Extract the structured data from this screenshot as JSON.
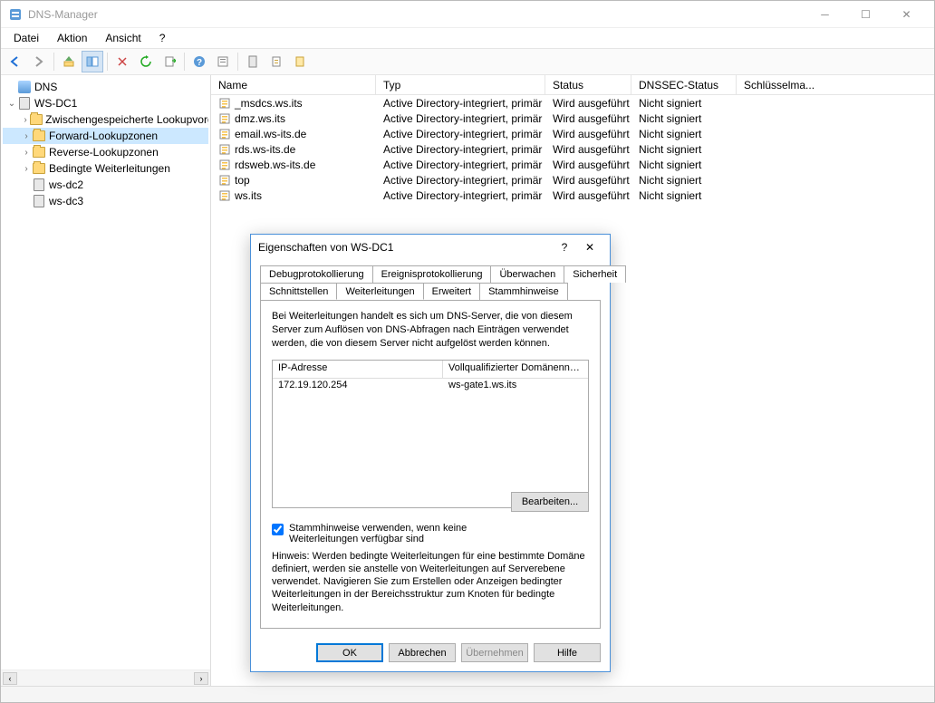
{
  "window": {
    "title": "DNS-Manager"
  },
  "menu": {
    "file": "Datei",
    "action": "Aktion",
    "view": "Ansicht",
    "help": "?"
  },
  "tree": {
    "root": "DNS",
    "server": "WS-DC1",
    "cached": "Zwischengespeicherte Lookupvorgänge",
    "forward": "Forward-Lookupzonen",
    "reverse": "Reverse-Lookupzonen",
    "conditional": "Bedingte Weiterleitungen",
    "node_wsdc2": "ws-dc2",
    "node_wsdc3": "ws-dc3"
  },
  "columns": {
    "name": "Name",
    "type": "Typ",
    "status": "Status",
    "dnssec": "DNSSEC-Status",
    "keymaster": "Schlüsselma..."
  },
  "zones": [
    {
      "name": "_msdcs.ws.its",
      "type": "Active Directory-integriert, primär",
      "status": "Wird ausgeführt",
      "dnssec": "Nicht signiert"
    },
    {
      "name": "dmz.ws.its",
      "type": "Active Directory-integriert, primär",
      "status": "Wird ausgeführt",
      "dnssec": "Nicht signiert"
    },
    {
      "name": "email.ws-its.de",
      "type": "Active Directory-integriert, primär",
      "status": "Wird ausgeführt",
      "dnssec": "Nicht signiert"
    },
    {
      "name": "rds.ws-its.de",
      "type": "Active Directory-integriert, primär",
      "status": "Wird ausgeführt",
      "dnssec": "Nicht signiert"
    },
    {
      "name": "rdsweb.ws-its.de",
      "type": "Active Directory-integriert, primär",
      "status": "Wird ausgeführt",
      "dnssec": "Nicht signiert"
    },
    {
      "name": "top",
      "type": "Active Directory-integriert, primär",
      "status": "Wird ausgeführt",
      "dnssec": "Nicht signiert"
    },
    {
      "name": "ws.its",
      "type": "Active Directory-integriert, primär",
      "status": "Wird ausgeführt",
      "dnssec": "Nicht signiert"
    }
  ],
  "dialog": {
    "title": "Eigenschaften von WS-DC1",
    "tabs_row1": {
      "debug": "Debugprotokollierung",
      "event": "Ereignisprotokollierung",
      "monitor": "Überwachen",
      "security": "Sicherheit"
    },
    "tabs_row2": {
      "interfaces": "Schnittstellen",
      "forwarders": "Weiterleitungen",
      "advanced": "Erweitert",
      "roothints": "Stammhinweise"
    },
    "desc": "Bei Weiterleitungen handelt es sich um DNS-Server, die von diesem Server zum Auflösen von DNS-Abfragen nach Einträgen verwendet werden, die von diesem Server nicht aufgelöst werden können.",
    "fwd_headers": {
      "ip": "IP-Adresse",
      "fqdn": "Vollqualifizierter Domänenname f..."
    },
    "fwd_rows": [
      {
        "ip": "172.19.120.254",
        "fqdn": "ws-gate1.ws.its"
      }
    ],
    "checkbox_label": "Stammhinweise verwenden, wenn keine Weiterleitungen verfügbar sind",
    "edit_button": "Bearbeiten...",
    "note": "Hinweis: Werden bedingte Weiterleitungen für eine bestimmte Domäne definiert, werden sie anstelle von Weiterleitungen auf Serverebene verwendet. Navigieren Sie zum Erstellen oder Anzeigen bedingter Weiterleitungen in der Bereichsstruktur zum Knoten für bedingte Weiterleitungen.",
    "buttons": {
      "ok": "OK",
      "cancel": "Abbrechen",
      "apply": "Übernehmen",
      "help": "Hilfe"
    }
  }
}
